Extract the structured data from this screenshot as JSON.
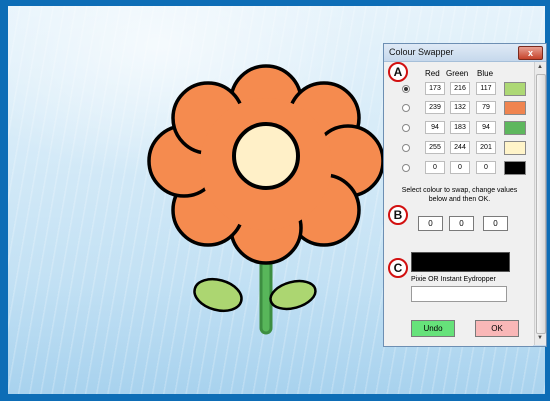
{
  "window": {
    "title": "Colour Swapper",
    "close_glyph": "x"
  },
  "badges": {
    "a": "A",
    "b": "B",
    "c": "C"
  },
  "headers": {
    "red": "Red",
    "green": "Green",
    "blue": "Blue"
  },
  "colours": [
    {
      "r": "173",
      "g": "216",
      "b": "117",
      "hex": "#add875",
      "selected": true
    },
    {
      "r": "239",
      "g": "132",
      "b": "79",
      "hex": "#ef844f",
      "selected": false
    },
    {
      "r": "94",
      "g": "183",
      "b": "94",
      "hex": "#5eb75e",
      "selected": false
    },
    {
      "r": "255",
      "g": "244",
      "b": "201",
      "hex": "#fff4c9",
      "selected": false
    },
    {
      "r": "0",
      "g": "0",
      "b": "0",
      "hex": "#000000",
      "selected": false
    }
  ],
  "instructions": {
    "line1": "Select colour to swap, change values",
    "line2": "below and then OK."
  },
  "edit": {
    "red": "0",
    "green": "0",
    "blue": "0",
    "preview_hex": "#000000"
  },
  "eyedropper": {
    "label": "Pixie OR Instant Eydropper",
    "value": ""
  },
  "buttons": {
    "undo": "Undo",
    "ok": "OK"
  },
  "colors": {
    "undo_bg": "#66e27a",
    "ok_bg": "#f9b7b7",
    "petal": "#f58b4f",
    "center": "#fff0c8",
    "leaf": "#acd671",
    "stem": "#58b65a",
    "outline": "#000000"
  }
}
